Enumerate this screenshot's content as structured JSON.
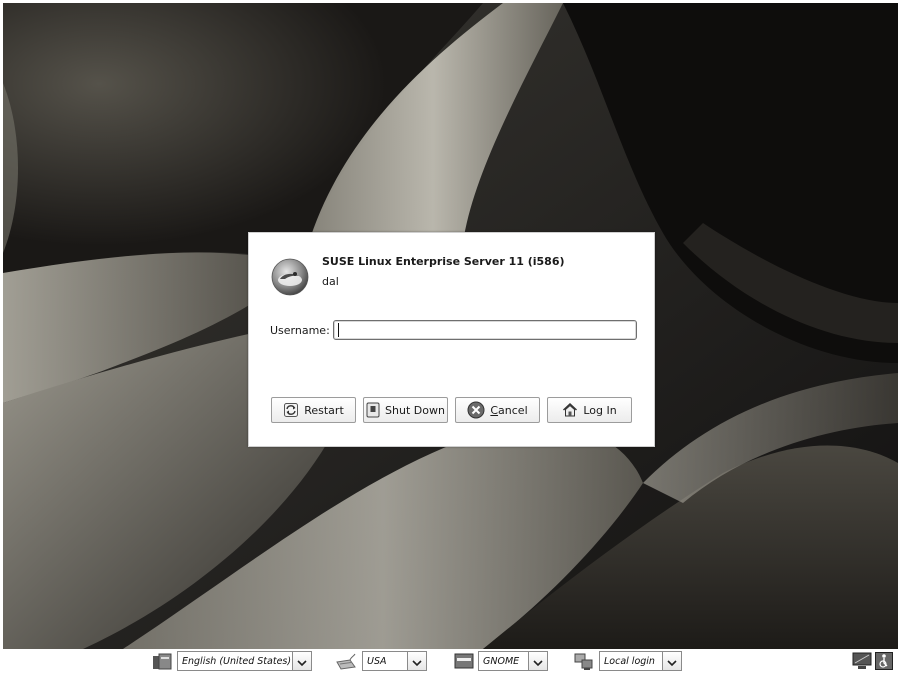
{
  "dialog": {
    "title": "SUSE Linux Enterprise Server 11 (i586)",
    "hostname": "dal",
    "username_label": "Username:",
    "username_value": "",
    "logo_icon": "suse-chameleon-logo"
  },
  "buttons": {
    "restart": {
      "label": "Restart",
      "icon": "restart-icon"
    },
    "shutdown": {
      "label": "Shut Down",
      "icon": "shutdown-icon"
    },
    "cancel": {
      "label_first": "C",
      "label_rest": "ancel",
      "icon": "cancel-icon"
    },
    "login": {
      "label": "Log In",
      "icon": "home-icon"
    }
  },
  "panel": {
    "language": {
      "value": "English (United States)",
      "icon": "language-icon"
    },
    "keyboard": {
      "value": "USA",
      "icon": "keyboard-icon"
    },
    "session": {
      "value": "GNOME",
      "icon": "session-icon"
    },
    "login_type": {
      "value": "Local login",
      "icon": "network-computers-icon"
    },
    "right_icons": [
      "xdmcp-chooser-icon",
      "accessibility-icon"
    ]
  },
  "colors": {
    "background_dark": "#141210",
    "dialog_bg": "#ffffff",
    "text": "#1a1a1a"
  }
}
